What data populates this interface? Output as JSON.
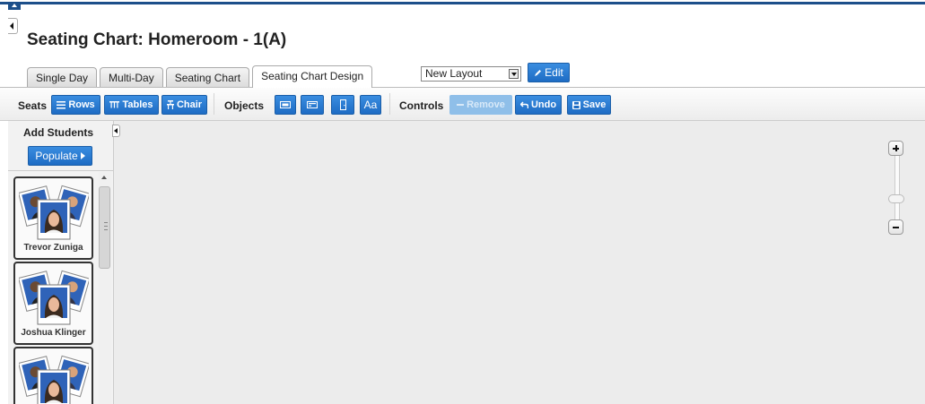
{
  "page": {
    "title": "Seating Chart: Homeroom - 1(A)"
  },
  "tabs": [
    {
      "label": "Single Day",
      "active": false
    },
    {
      "label": "Multi-Day",
      "active": false
    },
    {
      "label": "Seating Chart",
      "active": false
    },
    {
      "label": "Seating Chart Design",
      "active": true
    }
  ],
  "layout": {
    "selected": "New Layout",
    "edit_label": "Edit"
  },
  "toolbar": {
    "seats_label": "Seats",
    "rows_label": "Rows",
    "tables_label": "Tables",
    "chair_label": "Chair",
    "objects_label": "Objects",
    "text_label": "Aa",
    "controls_label": "Controls",
    "remove_label": "Remove",
    "undo_label": "Undo",
    "save_label": "Save"
  },
  "sidebar": {
    "title": "Add Students",
    "populate_label": "Populate",
    "students": [
      {
        "name": "Trevor Zuniga"
      },
      {
        "name": "Joshua Klinger"
      },
      {
        "name": ""
      }
    ]
  },
  "colors": {
    "accent": "#1c4f8a",
    "button": "#2a7bd2",
    "canvas": "#ececec"
  }
}
